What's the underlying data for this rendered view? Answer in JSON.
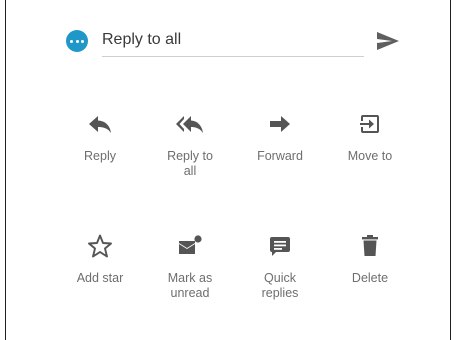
{
  "reply_bar": {
    "placeholder": "Reply to all",
    "avatar_icon": "more-dots-icon",
    "send_icon": "send-icon",
    "accent_color": "#1f97c9"
  },
  "actions": [
    {
      "label": "Reply",
      "icon": "reply-icon"
    },
    {
      "label": "Reply to\nall",
      "icon": "reply-all-icon"
    },
    {
      "label": "Forward",
      "icon": "forward-icon"
    },
    {
      "label": "Move to",
      "icon": "move-to-icon"
    },
    {
      "label": "Add star",
      "icon": "star-icon"
    },
    {
      "label": "Mark as\nunread",
      "icon": "mark-unread-icon"
    },
    {
      "label": "Quick\nreplies",
      "icon": "quick-replies-icon"
    },
    {
      "label": "Delete",
      "icon": "delete-icon"
    }
  ]
}
